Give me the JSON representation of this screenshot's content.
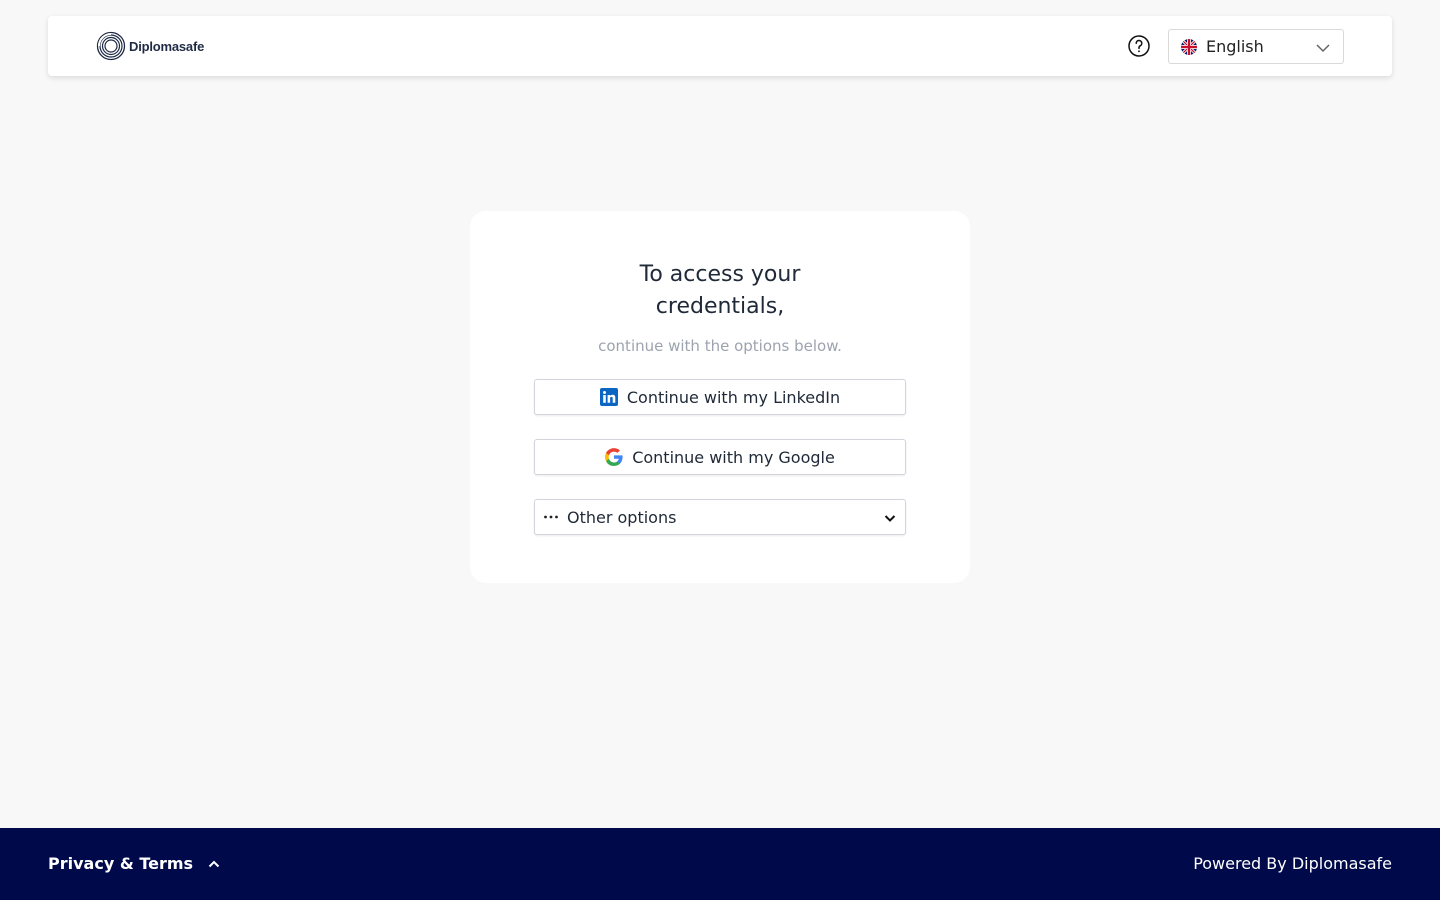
{
  "header": {
    "logo_text": "Diplomasafe",
    "language": {
      "selected": "English"
    }
  },
  "card": {
    "title_line1": "To access your",
    "title_line2": "credentials,",
    "subtitle": "continue with the options below.",
    "linkedin_label": "Continue with my LinkedIn",
    "google_label": "Continue with my Google",
    "other_label": "Other options"
  },
  "footer": {
    "privacy_label": "Privacy & Terms",
    "powered_by": "Powered By Diplomasafe"
  },
  "colors": {
    "background": "#f8f8f8",
    "footer": "#000a4a",
    "linkedin": "#0a66c2",
    "subtitle": "#9ca3af"
  },
  "icons": [
    "diplomasafe-logo-icon",
    "help-icon",
    "uk-flag-icon",
    "chevron-down-icon",
    "linkedin-icon",
    "google-icon",
    "more-dots-icon",
    "chevron-up-icon"
  ]
}
